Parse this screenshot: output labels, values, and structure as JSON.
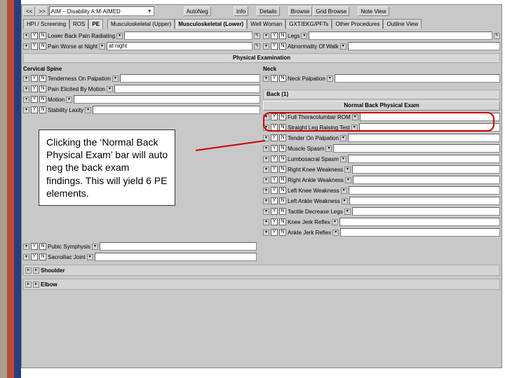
{
  "toolbar": {
    "prev": "<<",
    "next": ">>",
    "title_combo": "AIM – Disability A:M-AIMED",
    "buttons": [
      "AutoNeg",
      "Info",
      "Details",
      "Browse",
      "Grid Browse",
      "Note View"
    ]
  },
  "subtabs": [
    "HPI / Screening",
    "ROS",
    "PE"
  ],
  "tabs2": [
    "Musculoskeletal (Upper)",
    "Musculoskeletal (Lower)",
    "Well Woman",
    "GXT/EKG/PFTs",
    "Other Procedures",
    "Outline View"
  ],
  "upper": {
    "left_items": [
      {
        "label": "Lower Back Pain Radiating"
      },
      {
        "label": "Pain Worse at Night",
        "val": "at night"
      }
    ],
    "right_items": [
      {
        "label": "Legs"
      },
      {
        "label": "Abnormality Of Walk"
      }
    ]
  },
  "pe_bar": "Physical Examination",
  "left_heading": "Cervical Spine",
  "right_heading": "Neck",
  "cervical": [
    {
      "label": "Tenderness On Palpation"
    },
    {
      "label": "Pain Elicited By Motion"
    },
    {
      "label": "Motion"
    },
    {
      "label": "Stability Laxity"
    }
  ],
  "neck_item": {
    "label": "Neck Palpation"
  },
  "back_header": "Back (1)",
  "normal_bar": "Normal Back Physical Exam",
  "right_col_items": [
    {
      "label": "Full Thoracolumbar ROM"
    },
    {
      "label": "Straight Leg Raising Test"
    },
    {
      "label": "Tender On Palpation"
    },
    {
      "label": "Muscle Spasm"
    },
    {
      "label": "Lumbosacral Spasm"
    },
    {
      "label": "Right Knee Weakness"
    },
    {
      "label": "Right Ankle Weakness"
    },
    {
      "label": "Left Knee Weakness"
    },
    {
      "label": "Left Ankle Weakness"
    },
    {
      "label": "Tactile Decrease Legs"
    },
    {
      "label": "Knee Jerk Reflex"
    },
    {
      "label": "Ankle Jerk Reflex"
    }
  ],
  "lower_left": [
    {
      "label": "Pubic Symphysis"
    },
    {
      "label": "Sacroiliac Joint"
    }
  ],
  "expanders": [
    "Shoulder",
    "Elbow"
  ],
  "callout_text": "Clicking the ‘Normal Back Physical Exam’ bar will auto neg the back exam findings. This will yield 6 PE elements.",
  "yn": {
    "y": "Y",
    "n": "N"
  }
}
